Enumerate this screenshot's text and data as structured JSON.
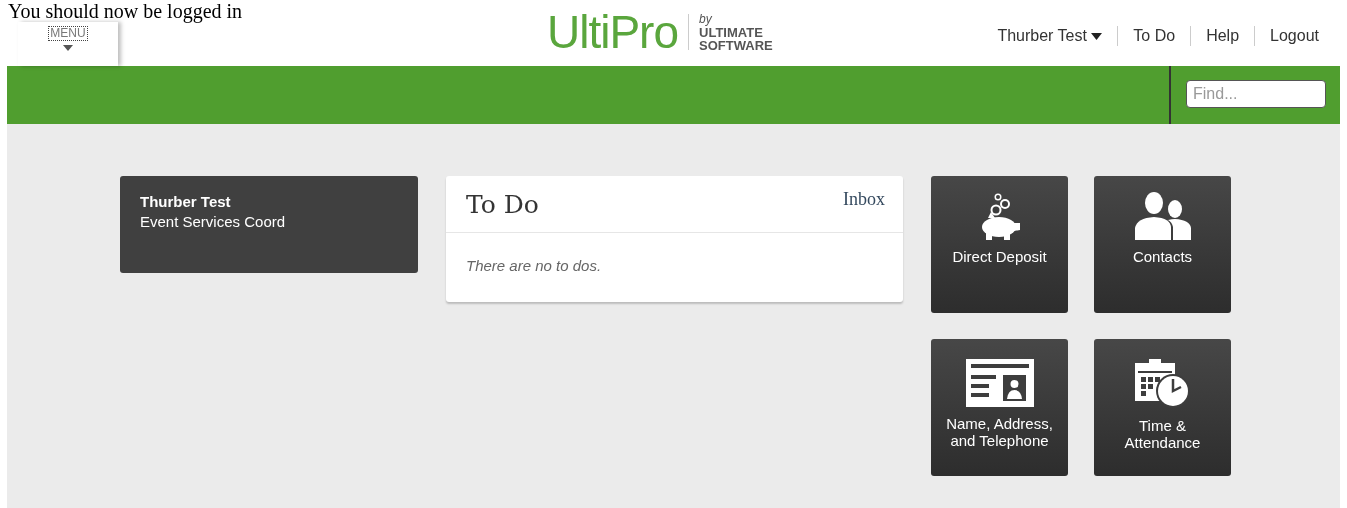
{
  "notice": "You should now be logged in",
  "menu": {
    "label": "MENU"
  },
  "logo": {
    "name": "UltiPro",
    "by": "by",
    "company_line_1": "ULTIMATE",
    "company_line_2": "SOFTWARE"
  },
  "user_nav": [
    {
      "label": "Thurber Test",
      "dropdown": true
    },
    {
      "label": "To Do",
      "dropdown": false
    },
    {
      "label": "Help",
      "dropdown": false
    },
    {
      "label": "Logout",
      "dropdown": false
    }
  ],
  "search": {
    "placeholder": "Find..."
  },
  "profile": {
    "name": "Thurber Test",
    "title": "Event Services Coord"
  },
  "todo": {
    "title": "To Do",
    "link": "Inbox",
    "empty_text": "There are no to dos."
  },
  "tiles": [
    {
      "kind": "deposit",
      "label": "Direct Deposit"
    },
    {
      "kind": "contacts",
      "label": "Contacts"
    },
    {
      "kind": "profile",
      "label": "Name, Address, and Telephone"
    },
    {
      "kind": "time",
      "label": "Time & Attendance"
    }
  ]
}
